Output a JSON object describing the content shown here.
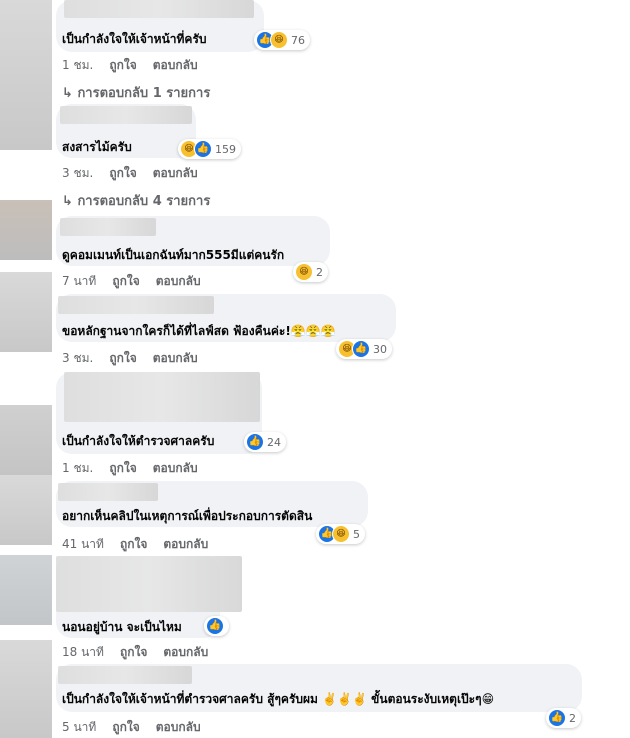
{
  "comments": [
    {
      "text": "เป็นกำลังใจให้เจ้าหน้าที่ครับ",
      "reaction_count": "76",
      "time": "1 ชม.",
      "like": "ถูกใจ",
      "reply": "ตอบกลับ",
      "replies_link": "การตอบกลับ 1 รายการ",
      "reactions": [
        "like-icon",
        "haha-icon"
      ]
    },
    {
      "text": "สงสารไม้ครับ",
      "reaction_count": "159",
      "time": "3 ชม.",
      "like": "ถูกใจ",
      "reply": "ตอบกลับ",
      "replies_link": "การตอบกลับ 4 รายการ",
      "reactions": [
        "haha-icon",
        "like-icon"
      ]
    },
    {
      "text": "ดูคอมเมนท์เป็นเอกฉันท์มาก555มีแต่คนรัก",
      "reaction_count": "2",
      "time": "7 นาที",
      "like": "ถูกใจ",
      "reply": "ตอบกลับ",
      "reactions": [
        "haha-icon"
      ]
    },
    {
      "text": "ขอหลักฐานจากใครก็ได้ที่ไลฟ์สด ฟ้องคืนค่ะ!",
      "text_emoji": "😤😤😤",
      "reaction_count": "30",
      "time": "3 ชม.",
      "like": "ถูกใจ",
      "reply": "ตอบกลับ",
      "reactions": [
        "haha-icon",
        "like-icon"
      ]
    },
    {
      "text": "เป็นกำลังใจให้ตำรวจศาลครับ",
      "reaction_count": "24",
      "time": "1 ชม.",
      "like": "ถูกใจ",
      "reply": "ตอบกลับ",
      "reactions": [
        "like-icon"
      ]
    },
    {
      "text": "อยากเห็นคลิปในเหตุการณ์เพื่อประกอบการตัดสิน",
      "reaction_count": "5",
      "time": "41 นาที",
      "like": "ถูกใจ",
      "reply": "ตอบกลับ",
      "reactions": [
        "like-icon",
        "haha-icon"
      ]
    },
    {
      "text": "นอนอยู่บ้าน จะเป็นไหม",
      "reaction_count": "",
      "time": "18 นาที",
      "like": "ถูกใจ",
      "reply": "ตอบกลับ",
      "reactions": [
        "like-icon"
      ]
    },
    {
      "text": "เป็นกำลังใจให้เจ้าหน้าที่ตำรวจศาลครับ สู้ๆครับผม",
      "text_emoji": "✌️✌️✌️",
      "text_tail": "ขั้นตอนระงับเหตุเป๊ะๆ",
      "text_tail_emoji": "😁",
      "reaction_count": "2",
      "time": "5 นาที",
      "like": "ถูกใจ",
      "reply": "ตอบกลับ",
      "reactions": [
        "like-icon"
      ]
    }
  ],
  "reply_arrow": "↳"
}
